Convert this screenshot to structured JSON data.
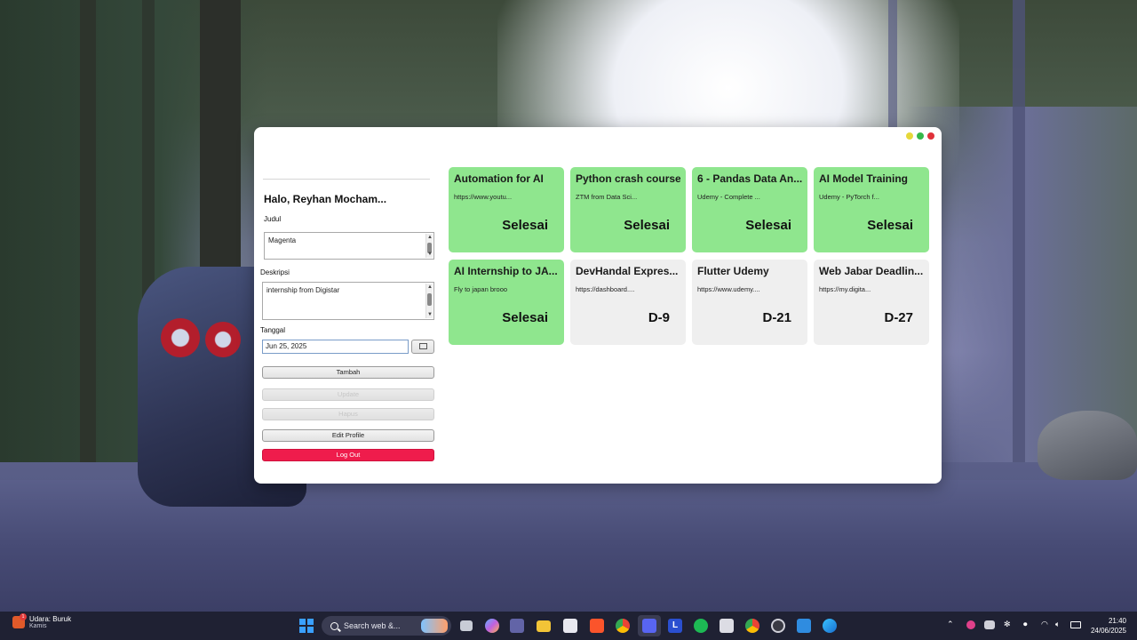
{
  "app": {
    "greeting": "Halo, Reyhan Mocham...",
    "judul_label": "Judul",
    "judul_value": "Magenta",
    "deskripsi_label": "Deskripsi",
    "deskripsi_value": "internship from Digistar",
    "tanggal_label": "Tanggal",
    "tanggal_value": "Jun 25, 2025",
    "buttons": {
      "tambah": "Tambah",
      "update": "Update",
      "hapus": "Hapus",
      "edit_profile": "Edit Profile",
      "logout": "Log Out"
    },
    "cards": [
      {
        "title": "Automation for AI",
        "desc": "https://www.youtu...",
        "status": "Selesai",
        "state": "done"
      },
      {
        "title": "Python crash course",
        "desc": "ZTM from Data Sci...",
        "status": "Selesai",
        "state": "done"
      },
      {
        "title": "6 - Pandas Data An...",
        "desc": "Udemy - Complete ...",
        "status": "Selesai",
        "state": "done"
      },
      {
        "title": "AI Model Training",
        "desc": "Udemy - PyTorch f...",
        "status": "Selesai",
        "state": "done"
      },
      {
        "title": "AI Internship to JA...",
        "desc": "Fly to japan brooo",
        "status": "Selesai",
        "state": "done"
      },
      {
        "title": "DevHandal Expres...",
        "desc": "https://dashboard....",
        "status": "D-9",
        "state": "pending"
      },
      {
        "title": "Flutter Udemy",
        "desc": "https://www.udemy....",
        "status": "D-21",
        "state": "pending"
      },
      {
        "title": "Web Jabar Deadlin...",
        "desc": "https://my.digita...",
        "status": "D-27",
        "state": "pending"
      }
    ],
    "colors": {
      "done": "#8fe68e",
      "pending": "#efefef",
      "logout": "#ef1c4c"
    }
  },
  "taskbar": {
    "weather_line1": "Udara: Buruk",
    "weather_line2": "Kamis",
    "weather_badge": "1",
    "search_placeholder": "Search web &...",
    "time": "21:40",
    "date": "24/06/2025",
    "pinned_icons": [
      "file-explorer-icon",
      "copilot-icon",
      "teams-icon",
      "folder-icon",
      "store-icon",
      "brave-icon",
      "chrome-icon",
      "discord-icon",
      "l-app-icon",
      "spotify-icon",
      "notepad-icon",
      "chrome-profile-icon",
      "obs-icon",
      "media-player-icon",
      "edge-icon"
    ]
  }
}
